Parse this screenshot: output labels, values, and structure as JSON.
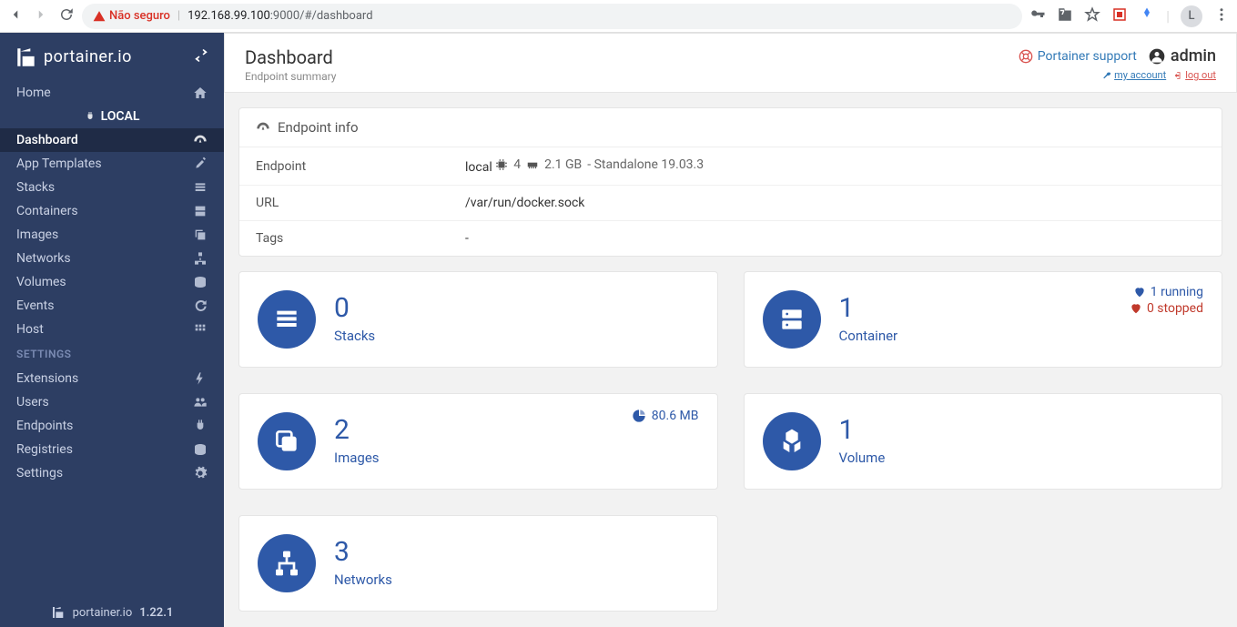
{
  "browser": {
    "insecure_label": "Não seguro",
    "url_host": "192.168.99.100",
    "url_rest": ":9000/#/dashboard",
    "avatar_letter": "L"
  },
  "brand": {
    "name": "portainer.io",
    "version": "1.22.1",
    "footer_name": "portainer.io"
  },
  "sidebar": {
    "home": "Home",
    "local": "LOCAL",
    "items": [
      {
        "label": "Dashboard"
      },
      {
        "label": "App Templates"
      },
      {
        "label": "Stacks"
      },
      {
        "label": "Containers"
      },
      {
        "label": "Images"
      },
      {
        "label": "Networks"
      },
      {
        "label": "Volumes"
      },
      {
        "label": "Events"
      },
      {
        "label": "Host"
      }
    ],
    "settings_header": "SETTINGS",
    "settings": [
      {
        "label": "Extensions"
      },
      {
        "label": "Users"
      },
      {
        "label": "Endpoints"
      },
      {
        "label": "Registries"
      },
      {
        "label": "Settings"
      }
    ]
  },
  "header": {
    "title": "Dashboard",
    "subtitle": "Endpoint summary",
    "support": "Portainer support",
    "user": "admin",
    "my_account": "my account",
    "logout": "log out"
  },
  "endpoint_panel": {
    "title": "Endpoint info",
    "rows": {
      "endpoint_label": "Endpoint",
      "endpoint_name": "local",
      "cpu": "4",
      "mem": "2.1 GB",
      "mode": "- Standalone 19.03.3",
      "url_label": "URL",
      "url_value": "/var/run/docker.sock",
      "tags_label": "Tags",
      "tags_value": "-"
    }
  },
  "tiles": {
    "stacks": {
      "count": "0",
      "label": "Stacks"
    },
    "containers": {
      "count": "1",
      "label": "Container",
      "running": "1 running",
      "stopped": "0 stopped"
    },
    "images": {
      "count": "2",
      "label": "Images",
      "size": "80.6 MB"
    },
    "volumes": {
      "count": "1",
      "label": "Volume"
    },
    "networks": {
      "count": "3",
      "label": "Networks"
    }
  }
}
